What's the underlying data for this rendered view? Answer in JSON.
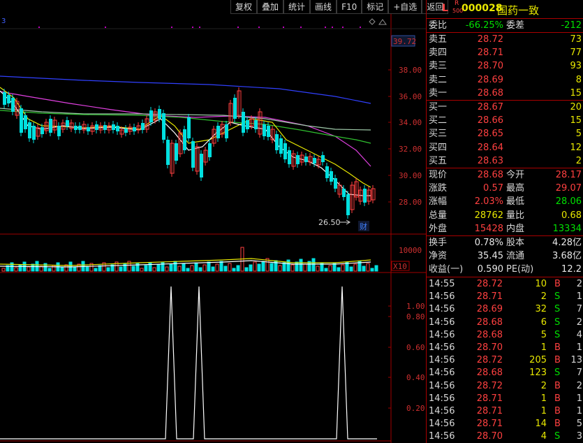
{
  "toolbar": {
    "buttons": [
      "复权",
      "叠加",
      "统计",
      "画线",
      "F10",
      "标记",
      "+自选",
      "返回"
    ]
  },
  "stock": {
    "mark_l": "L",
    "mark_r": "R",
    "mark_500": "500",
    "code": "000028",
    "name": "国药一致"
  },
  "chart": {
    "corner_digit": "3",
    "price_axis": [
      "39.72",
      "38.00",
      "36.00",
      "34.00",
      "32.00",
      "30.00",
      "28.00"
    ],
    "low_label": "26.50",
    "fin_label": "财",
    "vol_axis": [
      "10000",
      "X10"
    ],
    "ind_axis": [
      "1.00",
      "0.80",
      "0.60",
      "0.40",
      "0.20"
    ]
  },
  "quote": {
    "weibi_label": "委比",
    "weibi": "-66.25%",
    "weicha_label": "委差",
    "weicha": "-212",
    "asks": [
      {
        "label": "卖五",
        "price": "28.72",
        "vol": "73"
      },
      {
        "label": "卖四",
        "price": "28.71",
        "vol": "77"
      },
      {
        "label": "卖三",
        "price": "28.70",
        "vol": "93"
      },
      {
        "label": "卖二",
        "price": "28.69",
        "vol": "8"
      },
      {
        "label": "卖一",
        "price": "28.68",
        "vol": "15"
      }
    ],
    "bids": [
      {
        "label": "买一",
        "price": "28.67",
        "vol": "20"
      },
      {
        "label": "买二",
        "price": "28.66",
        "vol": "15"
      },
      {
        "label": "买三",
        "price": "28.65",
        "vol": "5"
      },
      {
        "label": "买四",
        "price": "28.64",
        "vol": "12"
      },
      {
        "label": "买五",
        "price": "28.63",
        "vol": "2"
      }
    ],
    "stats": [
      {
        "l1": "现价",
        "v1": "28.68",
        "l2": "今开",
        "v2": "28.17"
      },
      {
        "l1": "涨跌",
        "v1": "0.57",
        "l2": "最高",
        "v2": "29.07"
      },
      {
        "l1": "涨幅",
        "v1": "2.03%",
        "l2": "最低",
        "v2": "28.06"
      },
      {
        "l1": "总量",
        "v1": "28762",
        "l2": "量比",
        "v2": "0.68"
      },
      {
        "l1": "外盘",
        "v1": "15428",
        "l2": "内盘",
        "v2": "13334"
      }
    ],
    "fin": [
      {
        "l1": "换手",
        "v1": "0.78%",
        "l2": "股本",
        "v2": "4.28亿"
      },
      {
        "l1": "净资",
        "v1": "35.45",
        "l2": "流通",
        "v2": "3.68亿"
      },
      {
        "l1": "收益(一)",
        "v1": "0.590",
        "l2": "PE(动)",
        "v2": "12.2"
      }
    ]
  },
  "ticks": [
    {
      "time": "14:55",
      "price": "28.72",
      "vol": "10",
      "bs": "B",
      "n": "2"
    },
    {
      "time": "14:56",
      "price": "28.71",
      "vol": "2",
      "bs": "S",
      "n": "1"
    },
    {
      "time": "14:56",
      "price": "28.69",
      "vol": "32",
      "bs": "S",
      "n": "7"
    },
    {
      "time": "14:56",
      "price": "28.68",
      "vol": "6",
      "bs": "S",
      "n": "2"
    },
    {
      "time": "14:56",
      "price": "28.68",
      "vol": "5",
      "bs": "S",
      "n": "4"
    },
    {
      "time": "14:56",
      "price": "28.70",
      "vol": "1",
      "bs": "B",
      "n": "1"
    },
    {
      "time": "14:56",
      "price": "28.72",
      "vol": "205",
      "bs": "B",
      "n": "13"
    },
    {
      "time": "14:56",
      "price": "28.68",
      "vol": "123",
      "bs": "S",
      "n": "7"
    },
    {
      "time": "14:56",
      "price": "28.72",
      "vol": "2",
      "bs": "B",
      "n": "2"
    },
    {
      "time": "14:56",
      "price": "28.71",
      "vol": "1",
      "bs": "B",
      "n": "1"
    },
    {
      "time": "14:56",
      "price": "28.71",
      "vol": "1",
      "bs": "B",
      "n": "1"
    },
    {
      "time": "14:56",
      "price": "28.71",
      "vol": "14",
      "bs": "B",
      "n": "5"
    },
    {
      "time": "14:56",
      "price": "28.70",
      "vol": "4",
      "bs": "S",
      "n": "3"
    }
  ],
  "colors": {
    "up": "#ff4040",
    "down": "#00e0e0",
    "accent": "#e8e800",
    "border": "#a00000"
  }
}
